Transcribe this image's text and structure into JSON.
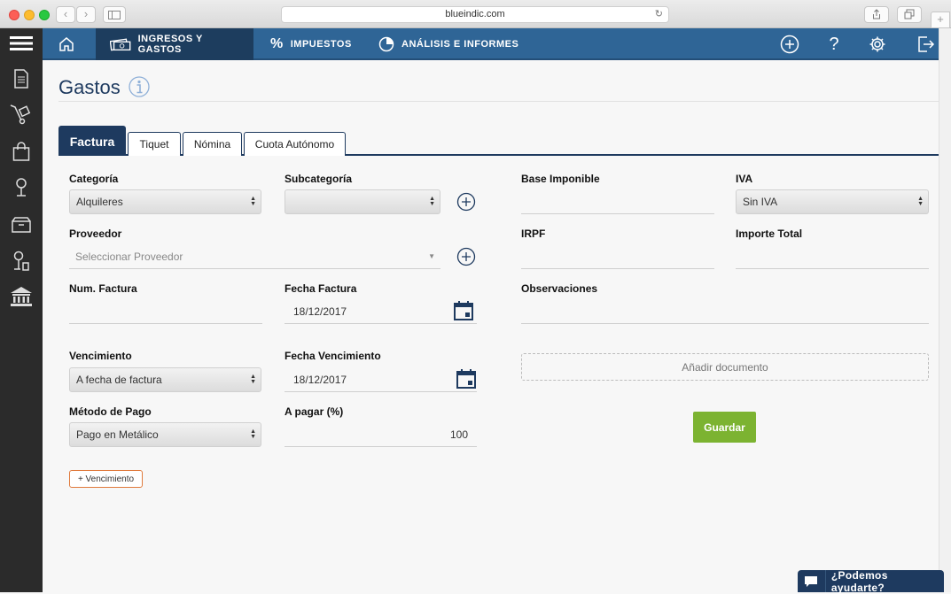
{
  "browser": {
    "url": "blueindic.com",
    "back": "‹",
    "forward": "›"
  },
  "sidebar": {
    "items": [
      {
        "icon": "menu-icon"
      },
      {
        "icon": "document-icon"
      },
      {
        "icon": "hand-truck-icon"
      },
      {
        "icon": "shopping-bag-icon"
      },
      {
        "icon": "person-icon"
      },
      {
        "icon": "box-icon"
      },
      {
        "icon": "person-key-icon"
      },
      {
        "icon": "bank-icon"
      }
    ]
  },
  "topnav": {
    "tabs": [
      {
        "label": "INGRESOS Y GASTOS",
        "icon": "money-icon",
        "active": true
      },
      {
        "label": "IMPUESTOS",
        "icon": "percent-icon",
        "active": false
      },
      {
        "label": "ANÁLISIS E INFORMES",
        "icon": "pie-chart-icon",
        "active": false
      }
    ],
    "actions": [
      {
        "icon": "add-circle-icon"
      },
      {
        "icon": "help-icon",
        "glyph": "?"
      },
      {
        "icon": "gear-icon"
      },
      {
        "icon": "logout-icon"
      }
    ]
  },
  "page": {
    "title": "Gastos",
    "tabs": [
      "Factura",
      "Tiquet",
      "Nómina",
      "Cuota Autónomo"
    ]
  },
  "form": {
    "categoria": {
      "label": "Categoría",
      "value": "Alquileres"
    },
    "subcategoria": {
      "label": "Subcategoría",
      "value": ""
    },
    "base_imponible": {
      "label": "Base Imponible",
      "value": ""
    },
    "iva": {
      "label": "IVA",
      "value": "Sin IVA"
    },
    "proveedor": {
      "label": "Proveedor",
      "placeholder": "Seleccionar Proveedor"
    },
    "irpf": {
      "label": "IRPF",
      "value": ""
    },
    "importe_total": {
      "label": "Importe Total",
      "value": ""
    },
    "num_factura": {
      "label": "Num. Factura",
      "value": ""
    },
    "fecha_factura": {
      "label": "Fecha Factura",
      "value": "18/12/2017"
    },
    "observaciones": {
      "label": "Observaciones",
      "value": ""
    },
    "vencimiento": {
      "label": "Vencimiento",
      "value": "A fecha de factura"
    },
    "fecha_vencimiento": {
      "label": "Fecha Vencimiento",
      "value": "18/12/2017"
    },
    "anadir_documento": "Añadir documento",
    "metodo_pago": {
      "label": "Método de Pago",
      "value": "Pago en Metálico"
    },
    "a_pagar": {
      "label": "A pagar (%)",
      "value": "100"
    },
    "guardar": "Guardar",
    "add_vencimiento": "+ Vencimiento"
  },
  "help": {
    "label": "¿Podemos ayudarte?"
  },
  "colors": {
    "nav": "#2f6596",
    "nav_active": "#1d3d5e",
    "primary": "#1e3a5f",
    "save": "#7cb331",
    "accent_border": "#e07a3c"
  }
}
